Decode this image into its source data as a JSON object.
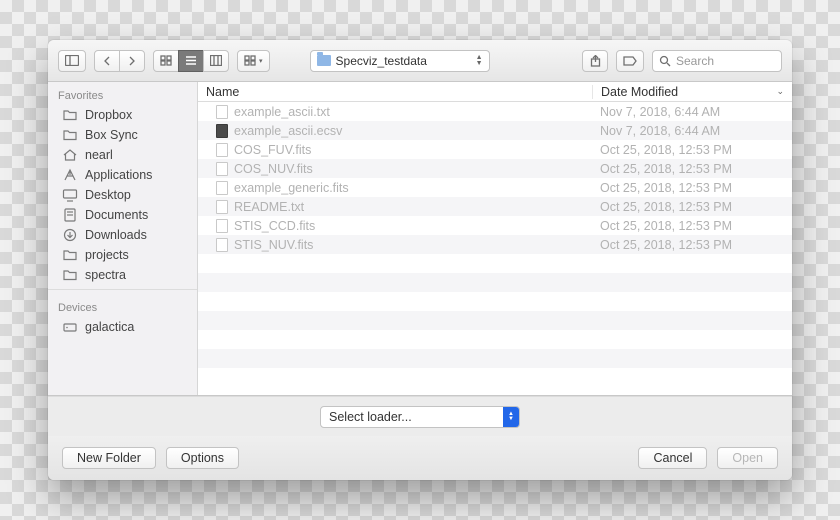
{
  "toolbar": {
    "path_label": "Specviz_testdata",
    "search_placeholder": "Search"
  },
  "sidebar": {
    "favorites_label": "Favorites",
    "devices_label": "Devices",
    "favorites": [
      {
        "label": "Dropbox",
        "icon": "folder"
      },
      {
        "label": "Box Sync",
        "icon": "folder"
      },
      {
        "label": "nearl",
        "icon": "home"
      },
      {
        "label": "Applications",
        "icon": "apps"
      },
      {
        "label": "Desktop",
        "icon": "desktop"
      },
      {
        "label": "Documents",
        "icon": "doc"
      },
      {
        "label": "Downloads",
        "icon": "downloads"
      },
      {
        "label": "projects",
        "icon": "folder"
      },
      {
        "label": "spectra",
        "icon": "folder"
      }
    ],
    "devices": [
      {
        "label": "galactica",
        "icon": "drive"
      }
    ]
  },
  "columns": {
    "name": "Name",
    "date": "Date Modified"
  },
  "files": [
    {
      "name": "example_ascii.txt",
      "date": "Nov 7, 2018, 6:44 AM",
      "icon": "file"
    },
    {
      "name": "example_ascii.ecsv",
      "date": "Nov 7, 2018, 6:44 AM",
      "icon": "file-dark"
    },
    {
      "name": "COS_FUV.fits",
      "date": "Oct 25, 2018, 12:53 PM",
      "icon": "file"
    },
    {
      "name": "COS_NUV.fits",
      "date": "Oct 25, 2018, 12:53 PM",
      "icon": "file"
    },
    {
      "name": "example_generic.fits",
      "date": "Oct 25, 2018, 12:53 PM",
      "icon": "file"
    },
    {
      "name": "README.txt",
      "date": "Oct 25, 2018, 12:53 PM",
      "icon": "file"
    },
    {
      "name": "STIS_CCD.fits",
      "date": "Oct 25, 2018, 12:53 PM",
      "icon": "file"
    },
    {
      "name": "STIS_NUV.fits",
      "date": "Oct 25, 2018, 12:53 PM",
      "icon": "file"
    }
  ],
  "loader": {
    "label": "Select loader..."
  },
  "footer": {
    "new_folder": "New Folder",
    "options": "Options",
    "cancel": "Cancel",
    "open": "Open"
  }
}
